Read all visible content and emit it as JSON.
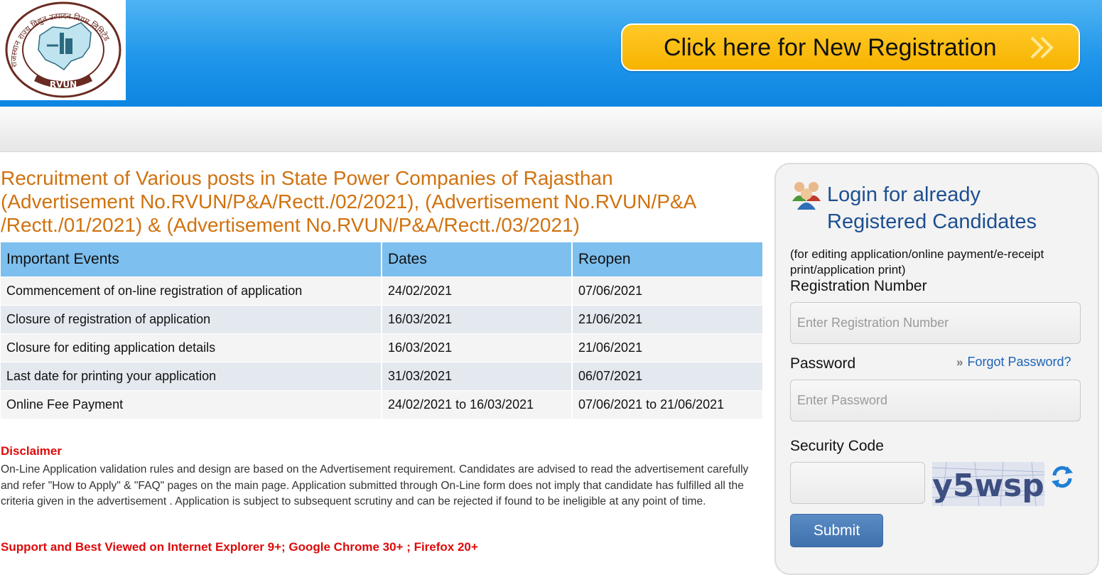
{
  "header": {
    "logo": {
      "text_top": "राजस्थान राज्य विद्युत उत्पादन निगम लिमिटेड",
      "abbr": "RVUN"
    },
    "new_registration_label": "Click here for New Registration",
    "button_color": "#f7b300"
  },
  "title": "Recruitment of Various posts in State Power Companies of Rajasthan (Advertisement No.RVUN/P&A/Rectt./02/2021), (Advertisement No.RVUN/P&A /Rectt./01/2021) & (Advertisement No.RVUN/P&A/Rectt./03/2021)",
  "events_table": {
    "headers": [
      "Important Events",
      "Dates",
      "Reopen"
    ],
    "rows": [
      [
        "Commencement of on-line registration of application",
        "24/02/2021",
        "07/06/2021"
      ],
      [
        "Closure of registration of application",
        "16/03/2021",
        "21/06/2021"
      ],
      [
        "Closure for editing application details",
        "16/03/2021",
        "21/06/2021"
      ],
      [
        "Last date for printing your application",
        "31/03/2021",
        "06/07/2021"
      ],
      [
        "Online Fee Payment",
        "24/02/2021 to 16/03/2021",
        "07/06/2021 to 21/06/2021"
      ]
    ]
  },
  "disclaimer": {
    "heading": "Disclaimer",
    "text": "On-Line Application validation rules and design are based on the Advertisement requirement. Candidates are advised to read the advertisement carefully and refer \"How to Apply\" & \"FAQ\" pages on the main page. Application submitted through On-Line form does not imply that candidate has fulfilled all the criteria given in the advertisement . Application is subject to subsequent scrutiny and can be rejected if found to be ineligible at any point of time."
  },
  "support_text": "Support and Best Viewed on Internet Explorer 9+; Google Chrome 30+ ; Firefox 20+",
  "login": {
    "title": "Login for already Registered Candidates",
    "note": "(for editing application/online payment/e-receipt print/application print)",
    "registration_label": "Registration Number",
    "registration_placeholder": "Enter Registration Number",
    "password_label": "Password",
    "password_placeholder": "Enter Password",
    "forgot_label": "Forgot Password?",
    "security_label": "Security Code",
    "captcha_text": "y5wsp",
    "submit_label": "Submit"
  },
  "colors": {
    "header_blue": "#1f96ea",
    "title_orange": "#d0720f",
    "table_header": "#7dbfee",
    "disclaimer_red": "#dd0a0a",
    "login_title": "#1d4f91",
    "link_blue": "#1d64b8",
    "submit_blue": "#4a7db8"
  },
  "icons": [
    "logo-emblem",
    "double-chevron-right-icon",
    "users-icon",
    "chevron-right-icon",
    "refresh-icon"
  ]
}
